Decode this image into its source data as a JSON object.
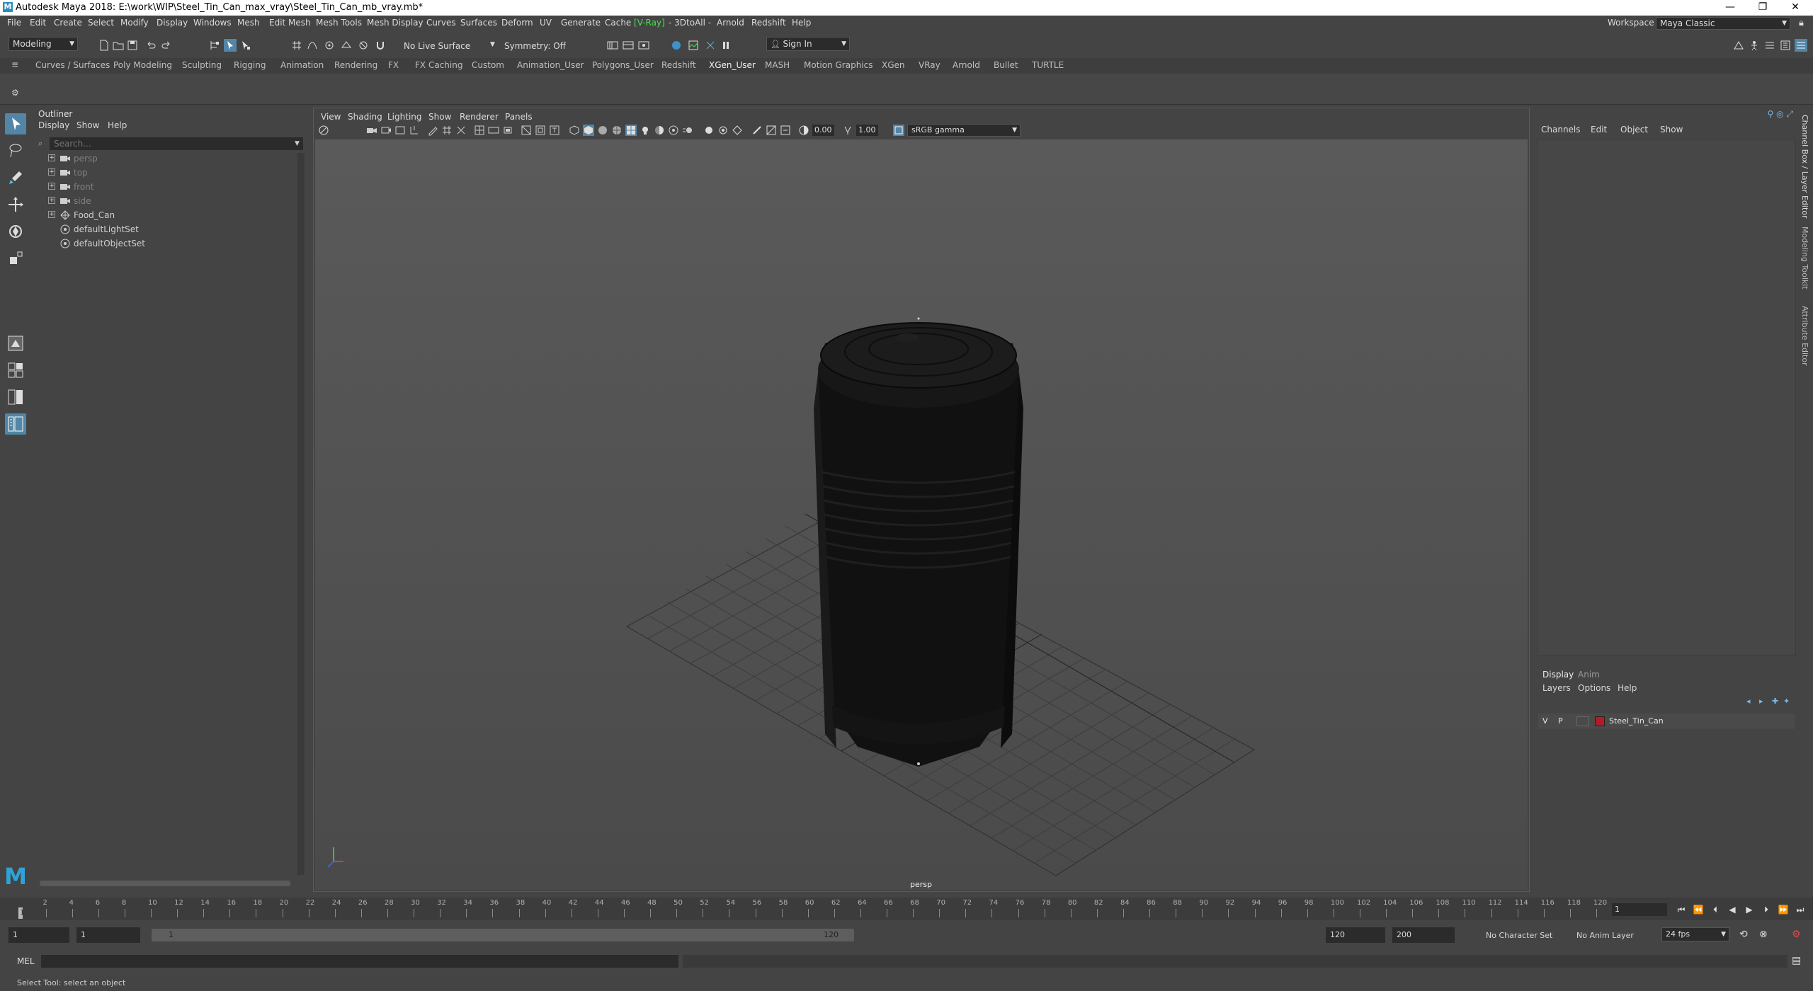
{
  "window": {
    "title": "Autodesk Maya 2018: E:\\work\\WIP\\Steel_Tin_Can_max_vray\\Steel_Tin_Can_mb_vray.mb*",
    "minimize": "—",
    "restore": "❐",
    "close": "✕"
  },
  "menus": [
    "File",
    "Edit",
    "Create",
    "Select",
    "Modify",
    "Display",
    "Windows",
    "Mesh",
    "Edit Mesh",
    "Mesh Tools",
    "Mesh Display",
    "Curves",
    "Surfaces",
    "Deform",
    "UV",
    "Generate",
    "Cache",
    "V-Ray",
    "- 3DtoAll -",
    "Arnold",
    "Redshift",
    "Help"
  ],
  "workspace": {
    "label": "Workspace :",
    "value": "Maya Classic"
  },
  "statusline": {
    "mode": "Modeling",
    "live_surface": "No Live Surface",
    "symmetry": "Symmetry: Off",
    "sign_in": "Sign In"
  },
  "shelf_tabs": [
    "Curves / Surfaces",
    "Poly Modeling",
    "Sculpting",
    "Rigging",
    "Animation",
    "Rendering",
    "FX",
    "FX Caching",
    "Custom",
    "Animation_User",
    "Polygons_User",
    "Redshift",
    "XGen_User",
    "MASH",
    "Motion Graphics",
    "XGen",
    "VRay",
    "Arnold",
    "Bullet",
    "TURTLE"
  ],
  "active_shelf_tab": "XGen_User",
  "outliner": {
    "title": "Outliner",
    "menus": [
      "Display",
      "Show",
      "Help"
    ],
    "search_placeholder": "Search...",
    "items": [
      {
        "label": "persp",
        "type": "camera",
        "dim": true
      },
      {
        "label": "top",
        "type": "camera",
        "dim": true
      },
      {
        "label": "front",
        "type": "camera",
        "dim": true
      },
      {
        "label": "side",
        "type": "camera",
        "dim": true
      },
      {
        "label": "Food_Can",
        "type": "group",
        "dim": false
      },
      {
        "label": "defaultLightSet",
        "type": "set",
        "dim": false
      },
      {
        "label": "defaultObjectSet",
        "type": "set",
        "dim": false
      }
    ]
  },
  "viewport": {
    "menus": [
      "View",
      "Shading",
      "Lighting",
      "Show",
      "Renderer",
      "Panels"
    ],
    "exposure": "0.00",
    "gamma": "1.00",
    "color_space": "sRGB gamma",
    "camera": "persp"
  },
  "channel_box": {
    "menus": [
      "Channels",
      "Edit",
      "Object",
      "Show"
    ]
  },
  "layer_editor": {
    "tabs": [
      "Display",
      "Anim"
    ],
    "menus": [
      "Layers",
      "Options",
      "Help"
    ],
    "layer": {
      "v": "V",
      "p": "P",
      "name": "Steel_Tin_Can",
      "color": "#b41a2a"
    }
  },
  "side_tabs": [
    "Channel Box / Layer Editor",
    "Modeling Toolkit",
    "Attribute Editor"
  ],
  "timeline": {
    "ticks": [
      "2",
      "4",
      "6",
      "8",
      "10",
      "12",
      "14",
      "16",
      "18",
      "20",
      "22",
      "24",
      "26",
      "28",
      "30",
      "32",
      "34",
      "36",
      "38",
      "40",
      "42",
      "44",
      "46",
      "48",
      "50",
      "52",
      "54",
      "56",
      "58",
      "60",
      "62",
      "64",
      "66",
      "68",
      "70",
      "72",
      "74",
      "76",
      "78",
      "80",
      "82",
      "84",
      "86",
      "88",
      "90",
      "92",
      "94",
      "96",
      "98",
      "100",
      "102",
      "104",
      "106",
      "108",
      "110",
      "112",
      "114",
      "116",
      "118",
      "120"
    ],
    "current_marker": "1",
    "current_frame": "1"
  },
  "range": {
    "start": "1",
    "anim_start": "1",
    "slider_start": "1",
    "slider_end": "120",
    "end": "120",
    "anim_end": "200",
    "character_set": "No Character Set",
    "anim_layer": "No Anim Layer",
    "fps": "24 fps"
  },
  "command": {
    "label": "MEL"
  },
  "help_line": "Select Tool: select an object"
}
